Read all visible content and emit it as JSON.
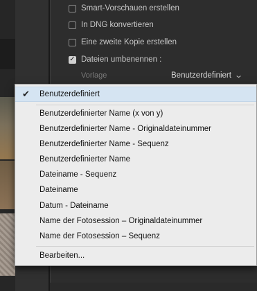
{
  "options": {
    "smart_previews": {
      "label": "Smart-Vorschauen erstellen",
      "checked": false
    },
    "dng": {
      "label": "In DNG konvertieren",
      "checked": false
    },
    "second_copy": {
      "label": "Eine zweite Kopie erstellen",
      "checked": false
    },
    "rename": {
      "label": "Dateien umbenennen :",
      "checked": true
    }
  },
  "template": {
    "label": "Vorlage",
    "value": "Benutzerdefiniert"
  },
  "menu": {
    "selected": "Benutzerdefiniert",
    "items": [
      "Benutzerdefinierter Name (x von y)",
      "Benutzerdefinierter Name - Originaldateinummer",
      "Benutzerdefinierter Name - Sequenz",
      "Benutzerdefinierter Name",
      "Dateiname - Sequenz",
      "Dateiname",
      "Datum - Dateiname",
      "Name der Fotosession – Originaldateinummer",
      "Name der Fotosession – Sequenz"
    ],
    "edit": "Bearbeiten..."
  }
}
